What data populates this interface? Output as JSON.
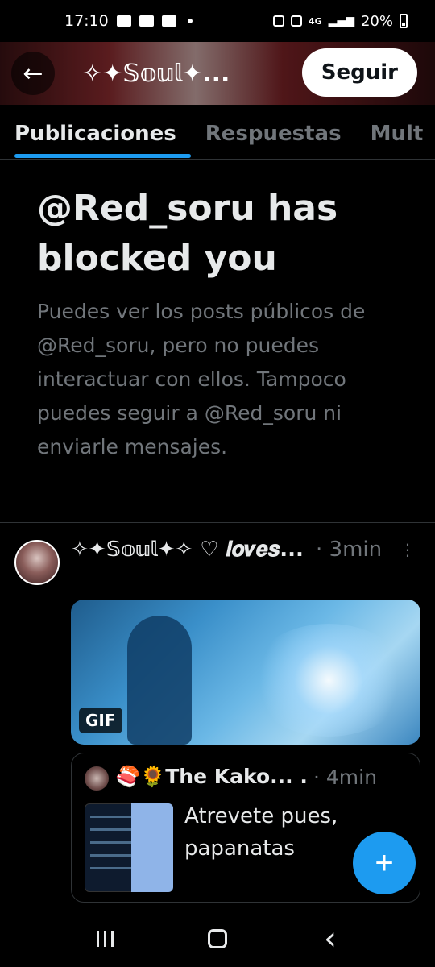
{
  "status_bar": {
    "time": "17:10",
    "network": "4G",
    "battery": "20%",
    "icons": [
      "folder-icon",
      "image-icon",
      "youtube-icon",
      "dot-icon",
      "recycle-icon",
      "mute-icon",
      "signal-icon",
      "battery-icon"
    ]
  },
  "header": {
    "back_icon": "←",
    "title": "✧✦𝕊𝕠𝕦𝕝✦...",
    "follow_label": "Seguir"
  },
  "tabs": [
    {
      "label": "Publicaciones",
      "active": true
    },
    {
      "label": "Respuestas",
      "active": false
    },
    {
      "label": "Mult",
      "active": false
    }
  ],
  "blocked": {
    "title": "@Red_soru has blocked you",
    "description": "Puedes ver los posts públicos de @Red_soru, pero no puedes interactuar con ellos. Tampoco puedes seguir a @Red_soru ni enviarle mensajes."
  },
  "post": {
    "author": "✧✦𝕊𝕠𝕦𝕝✦✧ ♡ 𝒍𝒐𝒗𝒆𝒔...",
    "time": "· 3min",
    "more_icon": "⋮",
    "media_badge": "GIF",
    "quote": {
      "author": "🍣🌻The Kako... ...",
      "time": "· 4min",
      "text": "Atrevete pues, papanatas"
    }
  },
  "fab_icon": "+",
  "nav": {
    "back_icon": "‹"
  },
  "colors": {
    "accent": "#1d9bf0",
    "background": "#000000",
    "muted_text": "#71767b"
  }
}
